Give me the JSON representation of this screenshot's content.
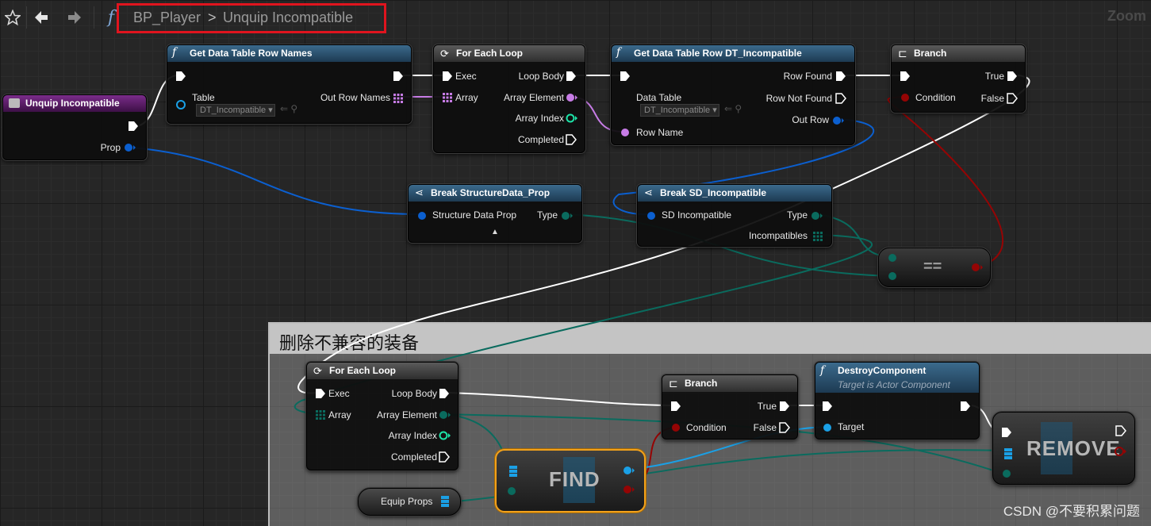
{
  "toolbar": {
    "star_icon": "star-icon",
    "back_icon": "arrow-left-icon",
    "forward_icon": "arrow-right-icon",
    "function_icon": "f",
    "breadcrumb_blueprint": "BP_Player",
    "breadcrumb_separator": ">",
    "breadcrumb_function": "Unquip Incompatible",
    "zoom_label": "Zoom"
  },
  "comment": {
    "title": "删除不兼容的装备"
  },
  "nodes": {
    "entry": {
      "title": "Unquip Incompatible",
      "prop_label": "Prop"
    },
    "get_row_names": {
      "title": "Get Data Table Row Names",
      "table_label": "Table",
      "table_value": "DT_Incompatible",
      "out_label": "Out Row Names"
    },
    "for_each_1": {
      "title": "For Each Loop",
      "exec": "Exec",
      "array": "Array",
      "loop_body": "Loop Body",
      "array_element": "Array Element",
      "array_index": "Array Index",
      "completed": "Completed"
    },
    "get_row": {
      "title": "Get Data Table Row DT_Incompatible",
      "data_table": "Data Table",
      "data_table_value": "DT_Incompatible",
      "row_name": "Row Name",
      "row_found": "Row Found",
      "row_not_found": "Row Not Found",
      "out_row": "Out Row"
    },
    "branch_1": {
      "title": "Branch",
      "condition": "Condition",
      "true_label": "True",
      "false_label": "False"
    },
    "break_prop": {
      "title": "Break StructureData_Prop",
      "input": "Structure Data Prop",
      "type": "Type"
    },
    "break_sd": {
      "title": "Break SD_Incompatible",
      "input": "SD Incompatible",
      "type": "Type",
      "incompatibles": "Incompatibles"
    },
    "equals": {
      "title": "=="
    },
    "for_each_2": {
      "title": "For Each Loop",
      "exec": "Exec",
      "array": "Array",
      "loop_body": "Loop Body",
      "array_element": "Array Element",
      "array_index": "Array Index",
      "completed": "Completed"
    },
    "branch_2": {
      "title": "Branch",
      "condition": "Condition",
      "true_label": "True",
      "false_label": "False"
    },
    "destroy": {
      "title": "DestroyComponent",
      "subtitle": "Target is Actor Component",
      "target": "Target"
    },
    "find": {
      "title": "FIND"
    },
    "remove": {
      "title": "REMOVE"
    },
    "equip_props": {
      "title": "Equip Props"
    }
  },
  "colors": {
    "exec": "#ffffff",
    "struct": "#0b5fcf",
    "enum": "#0a6b5e",
    "object": "#1aa0e6",
    "bool": "#950404",
    "name": "#c77ce6",
    "highlight_box": "#e0141e",
    "selected_node": "#f2a11b"
  },
  "watermark": "CSDN @不要积累问题"
}
